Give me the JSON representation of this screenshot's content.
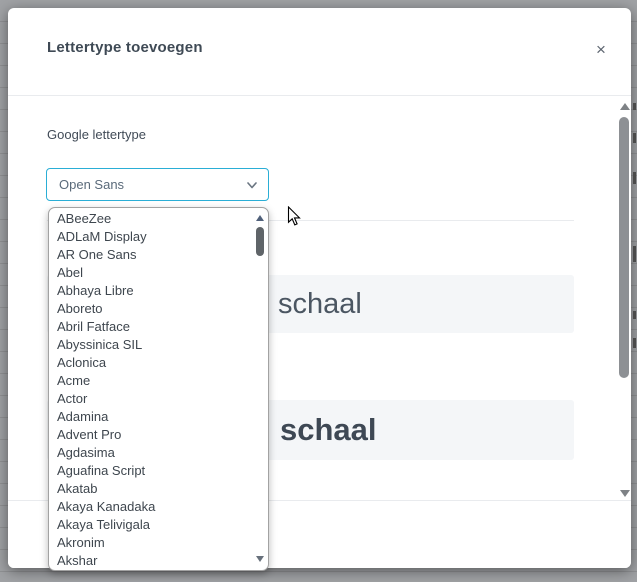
{
  "modal": {
    "title": "Lettertype toevoegen",
    "close_icon": "×",
    "body": {
      "google_font_label": "Google lettertype",
      "select_value": "Open Sans",
      "previews": {
        "regular_text": "schaal",
        "bold_text": "schaal"
      }
    }
  },
  "dropdown": {
    "options": [
      "ABeeZee",
      "ADLaM Display",
      "AR One Sans",
      "Abel",
      "Abhaya Libre",
      "Aboreto",
      "Abril Fatface",
      "Abyssinica SIL",
      "Aclonica",
      "Acme",
      "Actor",
      "Adamina",
      "Advent Pro",
      "Agdasima",
      "Aguafina Script",
      "Akatab",
      "Akaya Kanadaka",
      "Akaya Telivigala",
      "Akronim",
      "Akshar"
    ]
  },
  "icons": {
    "close": "close-x",
    "select_chevron": "chevron-down",
    "scroll_up": "triangle-up",
    "scroll_down": "triangle-down"
  },
  "colors": {
    "overlay_bg": "#a0a2a5",
    "accent_border": "#2aaed6",
    "title_text": "#3f4a55",
    "body_text": "#414b57",
    "preview_bg": "#f4f6f8",
    "divider": "#e9ebee",
    "scroll_thumb": "#8d9094",
    "dropdown_thumb": "#5f6468"
  }
}
